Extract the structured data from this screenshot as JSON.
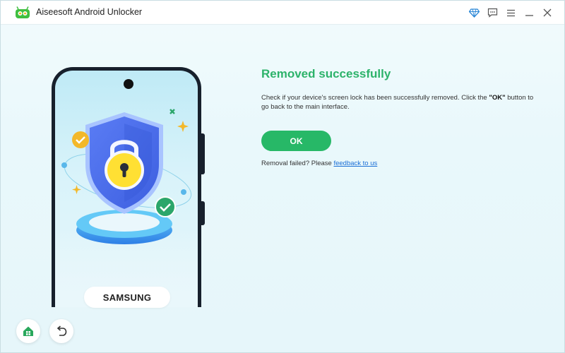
{
  "window": {
    "title": "Aiseesoft Android Unlocker",
    "icons": [
      "diamond-icon",
      "feedback-icon",
      "menu-icon",
      "minimize-icon",
      "close-icon"
    ]
  },
  "device": {
    "brand": "SAMSUNG"
  },
  "result": {
    "heading": "Removed successfully",
    "description_pre": "Check if your device's screen lock has been successfully removed. Click the ",
    "description_bold": "\"OK\"",
    "description_post": " button to go back to the main interface.",
    "ok_label": "OK",
    "fail_text": "Removal failed? Please ",
    "feedback_link": "feedback to us"
  },
  "bottom_nav": {
    "home_icon": "home-icon",
    "back_icon": "back-arrow-icon"
  },
  "colors": {
    "accent_green": "#27b867",
    "heading_green": "#2db36a",
    "link_blue": "#1a6fd6",
    "background": "#eaf8fb"
  }
}
